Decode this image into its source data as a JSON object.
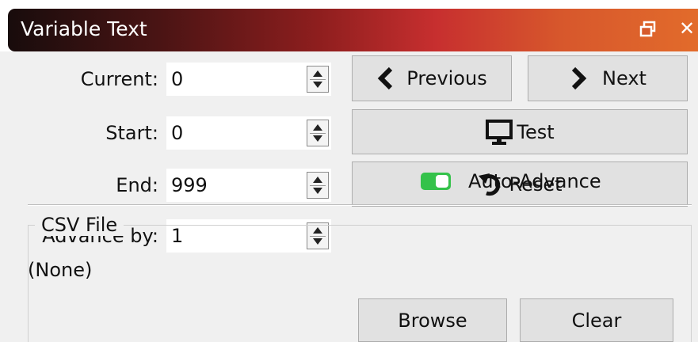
{
  "window": {
    "title": "Variable Text",
    "float_icon": "float-window-icon",
    "close_glyph": "✕"
  },
  "fields": {
    "current": {
      "label": "Current:",
      "value": "0"
    },
    "start": {
      "label": "Start:",
      "value": "0"
    },
    "end": {
      "label": "End:",
      "value": "999"
    },
    "advance": {
      "label": "Advance by:",
      "value": "1"
    }
  },
  "buttons": {
    "previous": "Previous",
    "next": "Next",
    "test": "Test",
    "reset": "Reset",
    "browse": "Browse",
    "clear": "Clear"
  },
  "auto_advance": {
    "label": "Auto-Advance",
    "enabled": true,
    "color": "#34c24a"
  },
  "csv": {
    "group_title": "CSV File",
    "value": "(None)"
  }
}
